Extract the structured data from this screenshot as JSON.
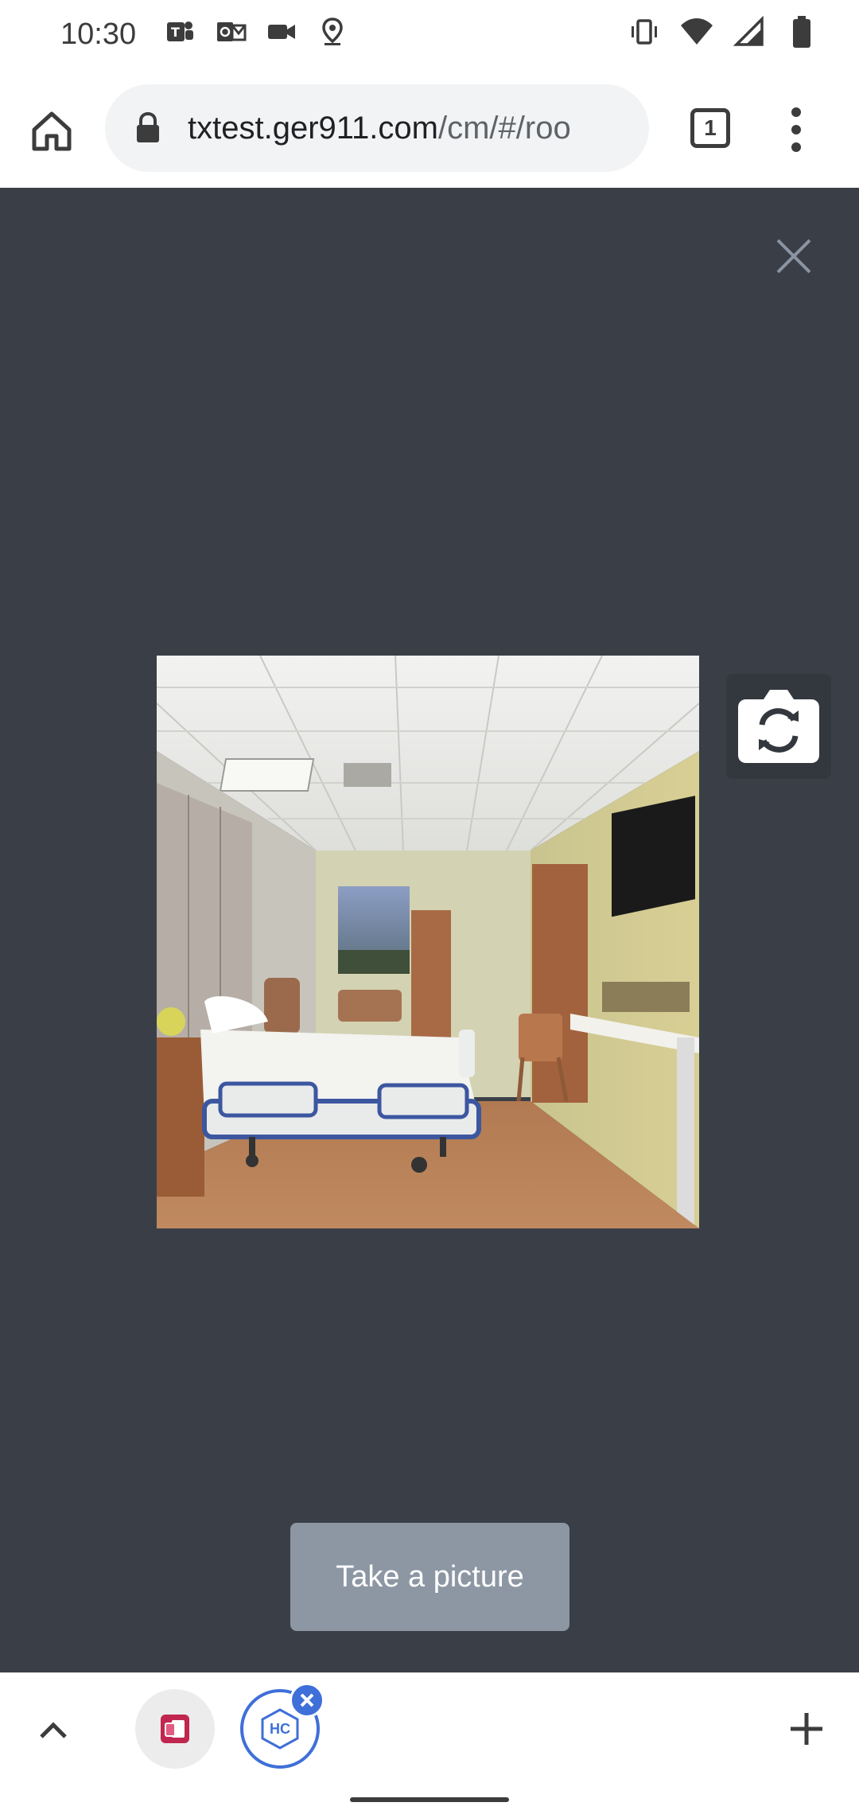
{
  "status_bar": {
    "time": "10:30",
    "left_icons": [
      "teams-icon",
      "outlook-icon",
      "video-camera-icon",
      "location-icon"
    ],
    "right_icons": [
      "vibrate-icon",
      "wifi-icon",
      "signal-icon",
      "battery-icon"
    ]
  },
  "browser": {
    "url_host": "txtest.ger911.com",
    "url_path": "/cm/#/roo",
    "tab_count": "1"
  },
  "camera": {
    "take_picture_label": "Take a picture"
  },
  "bottom_tabs": {
    "tab1_icon": "app-tab-icon",
    "tab2_label": "HC"
  },
  "colors": {
    "background": "#3a3f47",
    "button": "#8d97a4",
    "accent": "#3f6fd8"
  }
}
